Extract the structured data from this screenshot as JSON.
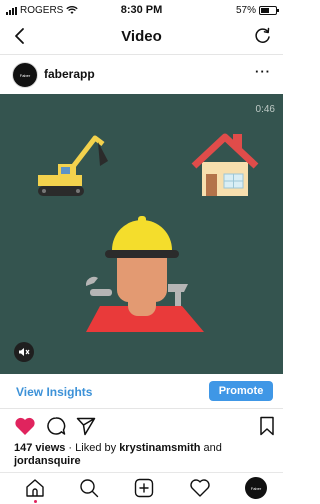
{
  "status_bar": {
    "carrier": "ROGERS",
    "time": "8:30 PM",
    "battery_pct": "57%",
    "battery_fraction": 0.57
  },
  "nav": {
    "title": "Video"
  },
  "post": {
    "username": "faberapp",
    "avatar_text": "Faber",
    "duration": "0:46",
    "insights_label": "View Insights",
    "promote_label": "Promote",
    "views_count": "147 views",
    "liked_by_prefix": " · Liked by ",
    "liked_by_1": "krystinamsmith",
    "liked_by_and": " and",
    "liked_by_2": "jordansquire"
  },
  "tabbar": {
    "profile_avatar_text": "Faber"
  },
  "colors": {
    "video_bg": "#34544f",
    "accent": "#3f97e6",
    "like": "#e0245e"
  }
}
